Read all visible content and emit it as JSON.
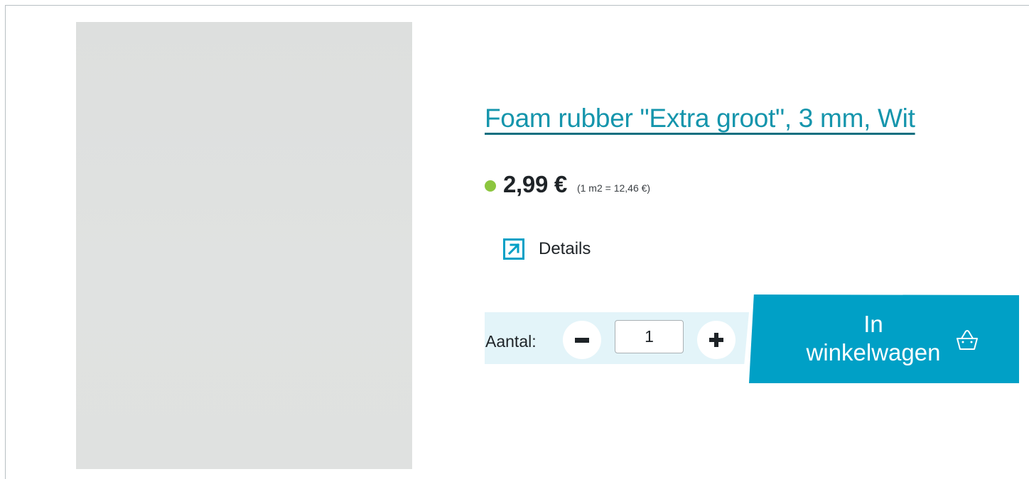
{
  "product": {
    "title": "Foam rubber \"Extra groot\", 3 mm, Wit",
    "price": "2,99 €",
    "unit_price": "(1 m2 = 12,46 €)",
    "availability_color": "#8cc63f"
  },
  "details": {
    "label": "Details",
    "icon": "external-arrow-icon"
  },
  "quantity": {
    "label": "Aantal:",
    "value": "1",
    "decrement_icon": "minus-icon",
    "increment_icon": "plus-icon"
  },
  "cart": {
    "label_line1": "In",
    "label_line2": "winkelwagen",
    "icon": "basket-icon"
  },
  "colors": {
    "accent": "#00a0c6",
    "title_link": "#1595ac",
    "quantity_bar": "#e3f4f9"
  }
}
